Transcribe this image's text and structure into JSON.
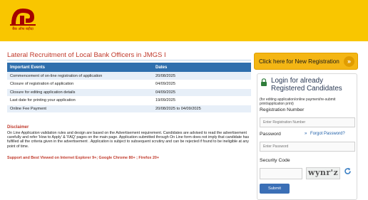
{
  "header": {
    "logo_text": "बैंक ऑफ बड़ौदा",
    "brand_color": "#f9c600",
    "logo_color": "#a40000"
  },
  "main": {
    "title": "Lateral Recruitment of Local Bank Officers in JMGS I",
    "table": {
      "headers": [
        "Important Events",
        "Dates"
      ],
      "rows": [
        [
          "Commencement of on-line registration of application",
          "20/08/2025"
        ],
        [
          "Closure of registration of application",
          "04/09/2025"
        ],
        [
          "Closure for editing application details",
          "04/09/2025"
        ],
        [
          "Last date for printing your application",
          "19/09/2025"
        ],
        [
          "Online Fee Payment",
          "20/08/2025 to 04/09/2025"
        ]
      ]
    },
    "disclaimer_heading": "Disclaimer",
    "disclaimer_body": "On Line Application validation rules and design are based on the Advertisement requirement. Candidates are advised to read the advertisement carefully and refer 'How to Apply' & 'FAQ' pages on the main page. Application submitted through On Line form does not imply that candidate has fulfilled all the criteria given in the advertisement . Application is subject to subsequent scrutiny and can be rejected if found to be ineligible at any point of time.",
    "browser_note": "Support and Best Viewed on Internet Explorer 9+; Google Chrome 80+ ; Firefox 20+"
  },
  "sidebar": {
    "new_registration_label": "Click here for New Registration",
    "chevron_icon": "double-chevron-right-icon",
    "login_title_line1": "Login for already",
    "login_title_line2": "Registered Candidates",
    "login_subtitle": "(for editing application/online payment/re-submit print/application print)",
    "registration_label": "Registration Number",
    "registration_placeholder": "Enter Registration Number",
    "password_label": "Password",
    "password_placeholder": "Enter Password",
    "forgot_label": "Forgot Password?",
    "security_label": "Security Code",
    "captcha_text": "wynr'z",
    "submit_label": "Submit"
  }
}
